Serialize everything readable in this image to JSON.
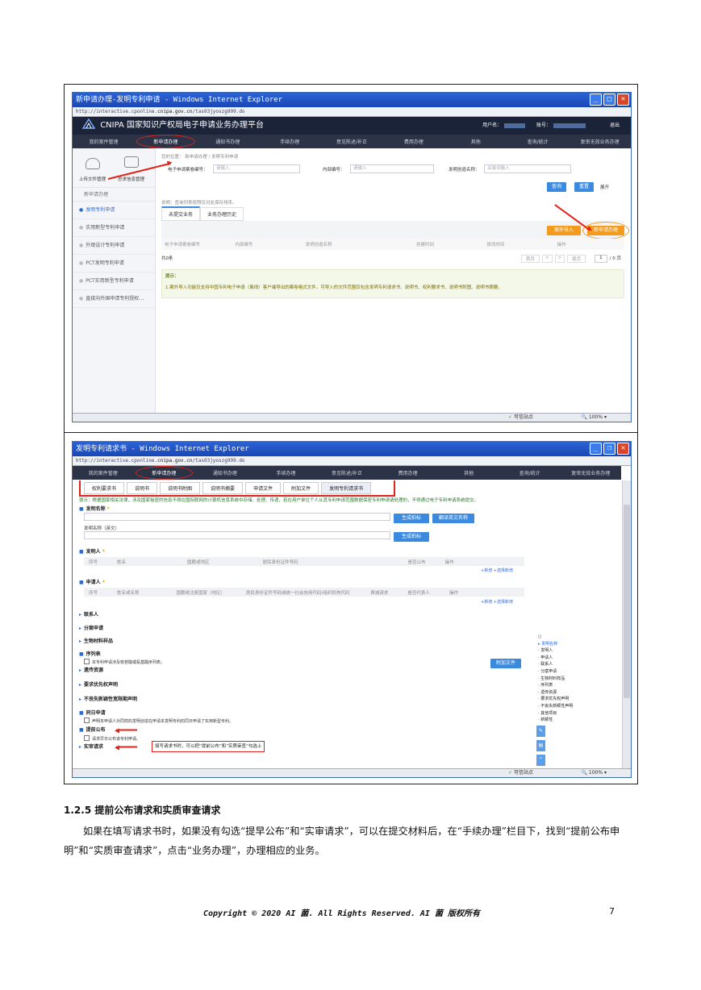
{
  "window1": {
    "title": "新申请办理-发明专利申请 - Windows Internet Explorer",
    "url_prefix": "http://interactive.cponline.",
    "url_host": "cnipa.gov.cn",
    "url_path": "/tas03jyoszg999.do",
    "header_brand": "CNIPA 国家知识产权局电子申请业务办理平台",
    "user_label": "用户名：",
    "account_label": "账号：",
    "logout": "退出",
    "nav": [
      "我的案件管理",
      "新申请办理",
      "通知书办理",
      "手续办理",
      "意见陈述/补正",
      "费用办理",
      "其他",
      "查询/统计",
      "复审无效业务办理"
    ],
    "side_tools": [
      "上传文件管理",
      "总求信息管理"
    ],
    "side_head": "新申请办理",
    "side_items": [
      "发明专利申请",
      "实用新型专利申请",
      "外观设计专利申请",
      "PCT发明专利申请",
      "PCT实用新型专利申请",
      "直接向外国申请专利授权…"
    ],
    "crumb": "您的位置：  新申请办理  /  发明专利申请",
    "field1_label": "电子申请案卷编号：",
    "field1_placeholder": "请输入",
    "field2_label": "内部编号：",
    "field2_placeholder": "请输入",
    "field3_label": "发明创造名称：",
    "field3_placeholder": "关键词输入",
    "query_btn": "查询",
    "reset_btn": "重置",
    "collapse": "展开",
    "note": "说明：查询列表按照仅对此保存排序。",
    "tab1": "未提交业务",
    "tab2": "业务办理历史",
    "import_btn": "案外导入",
    "new_btn": "新申请办理",
    "columns": [
      "电子申请案卷编号",
      "内部编号",
      "发明创造名称",
      "创建时间",
      "修改时间",
      "操作"
    ],
    "total": "共0条",
    "pager_first": "首页",
    "pager_last": "尾页",
    "pager_page": "1",
    "pager_total": "/ 0 页",
    "tip_title": "提示：",
    "tip_body": "1.案外导入功能仅支持中国专利电子申请（离线）客户端导出的案卷格式文件，可导入的文件范围仅包含发明专利请求书、说明书、权利要求书、说明书附图、说明书摘要。",
    "status_site": "可信站点",
    "status_zoom": "100%"
  },
  "window2": {
    "title": "发明专利请求书 - Windows Internet Explorer",
    "url_prefix": "http://interactive.cponline.",
    "url_host": "cnipa.gov.cn",
    "url_path": "/tas03jyoszg999.do",
    "nav": [
      "我的案件管理",
      "新申请办理",
      "通知书办理",
      "手续办理",
      "意见陈述/补正",
      "费用办理",
      "其他",
      "查询/统计",
      "复审无效业务办理"
    ],
    "subtabs": [
      "权利要求书",
      "说明书",
      "说明书附图",
      "说明书摘要",
      "申请文件",
      "附加文件",
      "发明专利请求书"
    ],
    "notice": "提示：根据国家相关法律，涉及国家秘密的信息不得在国际联网的计算机信息系统中存储、处理、传递，若在用户单位个人从其专利申请范围数据保密专利申请请处理的，不得通过电子专利申请系统提交。",
    "s_name": "发明名称",
    "s_name_en": "发明名称（英文）",
    "gen_btn": "生成拍标",
    "trans_btn": "翻译英文名称",
    "s_inventor": "发明人",
    "inv_cols": [
      "序号",
      "姓名",
      "国籍或地区",
      "居民身份证件号码",
      "是否公布",
      "操作"
    ],
    "add_link": "+新增  +选择新增",
    "s_applicant": "申请人",
    "app_cols": [
      "序号",
      "姓名或名称",
      "国籍或注册国家（地区）",
      "居民身份证件号码或统一社会信用代码/组织机构代码",
      "费减请求",
      "是否代表人",
      "操作"
    ],
    "s_contact": "联系人",
    "s_divisional": "分案申请",
    "s_bio": "生物材料样品",
    "s_seq": "序列表",
    "seq_cb": "本专利申请涉及核苷酸或氨基酸序列表。",
    "attach_btn": "附加文件",
    "s_genetic": "遗传资源",
    "s_priority": "要求优先权声明",
    "s_novelty": "不丧失新颖性宽限期声明",
    "s_sameday": "同日申请",
    "sameday_cb": "声明本申请人对同样的发明创造在申请本发明专利的同日申请了实用新型专利。",
    "s_early": "提前公布",
    "early_cb": "请求早日公布该专利申请。",
    "s_exam": "实审请求",
    "annotation": "填写请求书时，可以把“提前公布”和“实质审查”勾选上",
    "right_list": [
      "发明名称",
      "发明人",
      "申请人",
      "联系人",
      "分案申请",
      "生物材料样品",
      "序列表",
      "遗传资源",
      "要求优先权声明",
      "不丧失新颖性声明",
      "其他项目",
      "新颖性"
    ],
    "status_site": "可信站点",
    "status_zoom": "100%"
  },
  "section": {
    "heading": "1.2.5  提前公布请求和实质审查请求",
    "paragraph": "如果在填写请求书时，如果没有勾选“提早公布”和“实审请求”，可以在提交材料后，在“手续办理”栏目下，找到“提前公布申明”和“实质审查请求”，点击“业务办理”，办理相应的业务。"
  },
  "footer": {
    "copyright": "Copyright © 2020 AI 菌. All Rights Reserved. AI 菌 版权所有",
    "page": "7"
  },
  "colors": {
    "accent": "#2b6bd6",
    "annotation_red": "#e2231a",
    "orange": "#f39b1d"
  }
}
